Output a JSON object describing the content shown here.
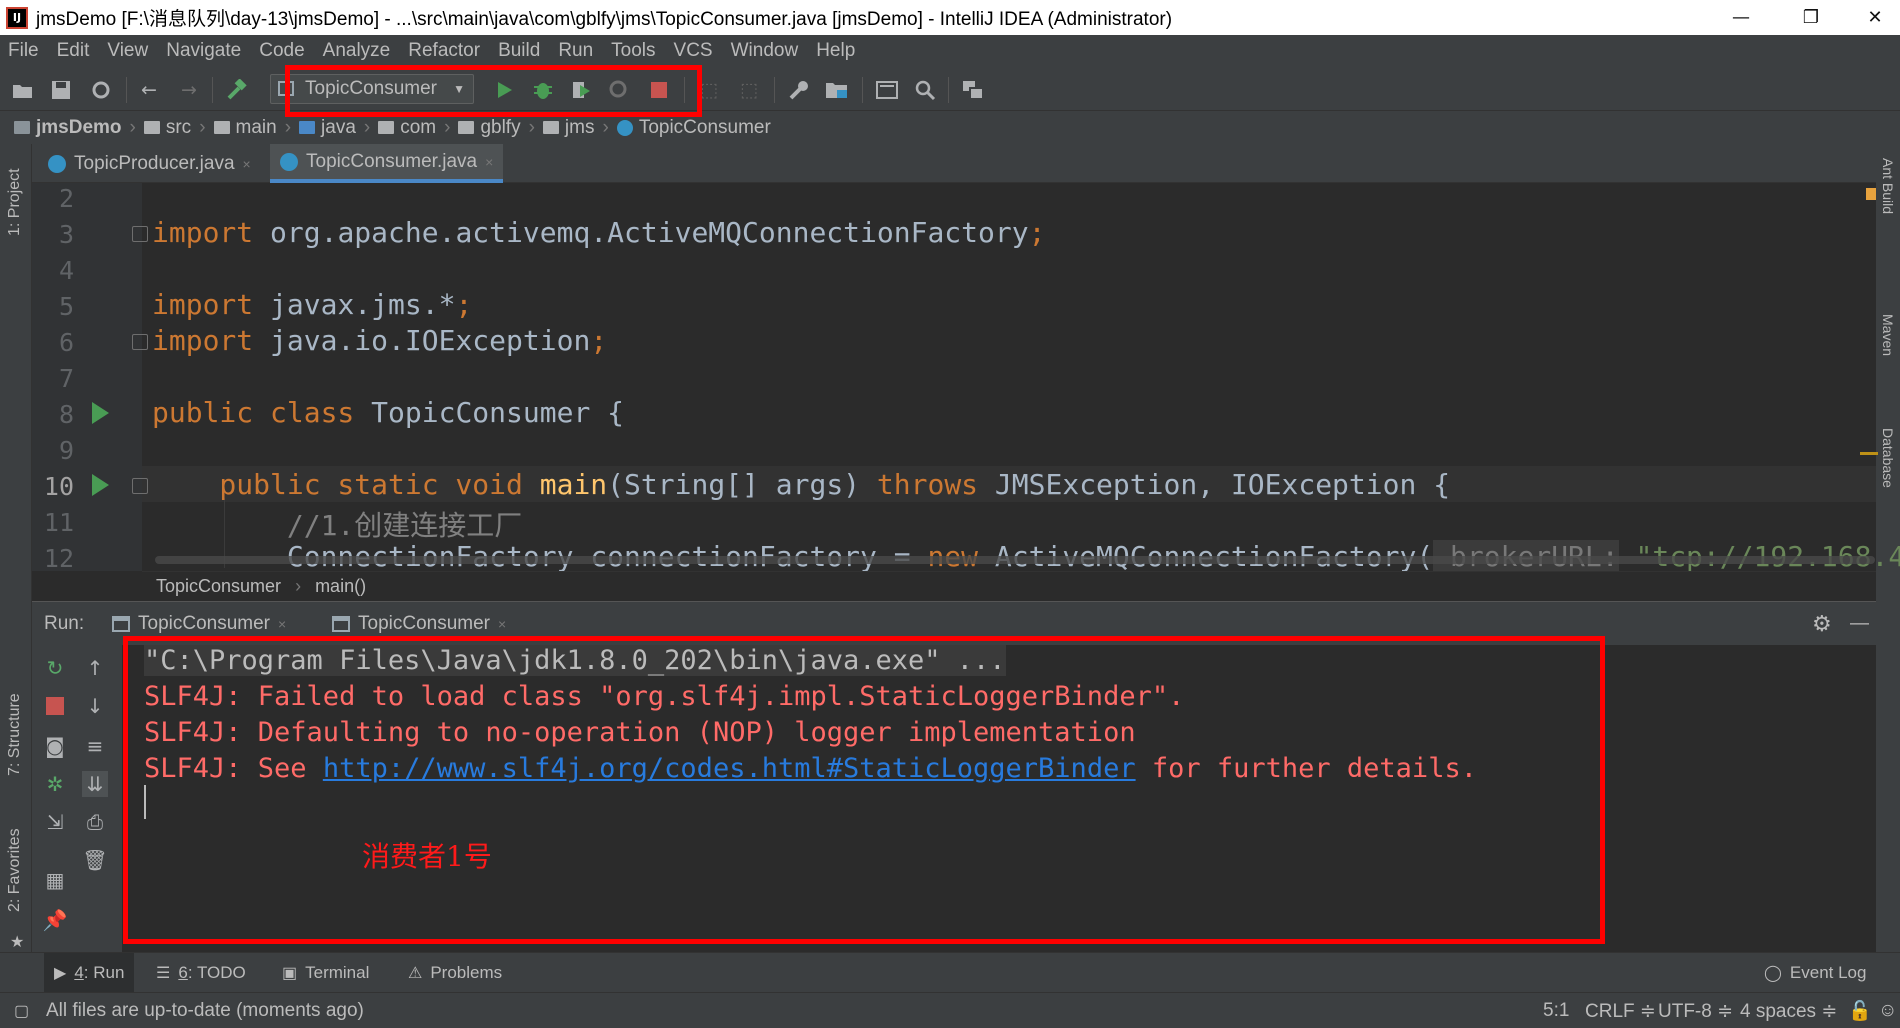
{
  "window": {
    "title": "jmsDemo [F:\\消息队列\\day-13\\jmsDemo] - ...\\src\\main\\java\\com\\gblfy\\jms\\TopicConsumer.java [jmsDemo] - IntelliJ IDEA (Administrator)",
    "app_icon": "IJ",
    "minimize": "—",
    "restore": "❐",
    "close": "✕"
  },
  "menu": [
    "File",
    "Edit",
    "View",
    "Navigate",
    "Code",
    "Analyze",
    "Refactor",
    "Build",
    "Run",
    "Tools",
    "VCS",
    "Window",
    "Help"
  ],
  "toolbar": {
    "run_config": "TopicConsumer",
    "icons": [
      "open-folder-icon",
      "save-icon",
      "sync-icon",
      "back-arrow-icon",
      "forward-arrow-icon",
      "build-hammer-icon",
      "run-icon",
      "debug-icon",
      "coverage-icon",
      "profile-icon",
      "stop-icon",
      "attach-icon",
      "update-icon",
      "settings-wrench-icon",
      "project-structure-icon",
      "terminal-icon",
      "search-icon",
      "tasks-icon"
    ]
  },
  "breadcrumb": [
    "jmsDemo",
    "src",
    "main",
    "java",
    "com",
    "gblfy",
    "jms",
    "TopicConsumer"
  ],
  "left_stripe": {
    "project": "1: Project",
    "structure": "7: Structure",
    "favorites": "2: Favorites"
  },
  "right_stripe": {
    "ant": "Ant Build",
    "maven": "Maven",
    "database": "Database"
  },
  "tabs": [
    {
      "label": "TopicProducer.java",
      "close": "×"
    },
    {
      "label": "TopicConsumer.java",
      "close": "×"
    }
  ],
  "editor": {
    "line_numbers": [
      "2",
      "3",
      "4",
      "5",
      "6",
      "7",
      "8",
      "9",
      "10",
      "11",
      "12"
    ],
    "lines": {
      "l3a": "import",
      "l3b": " org.apache.activemq.ActiveMQConnectionFactory",
      "l3c": ";",
      "l5a": "import",
      "l5b": " javax.jms.*",
      "l5c": ";",
      "l6a": "import",
      "l6b": " java.io.IOException",
      "l6c": ";",
      "l8a": "public class",
      "l8b": " TopicConsumer {",
      "l10a": "    public static void",
      "l10b": " main",
      "l10c": "(String[] args) ",
      "l10d": "throws",
      "l10e": " JMSException, IOException {",
      "l11": "        //1.创建连接工厂",
      "l12a": "        ConnectionFactory connectionFactory = ",
      "l12b": "new",
      "l12c": " ActiveMQConnectionFactory(",
      "l12d": " brokerURL:",
      "l12e": " \"tcp://192.168.4"
    },
    "crumb_class": "TopicConsumer",
    "crumb_method": "main()"
  },
  "run": {
    "label": "Run:",
    "tabs": [
      {
        "label": "TopicConsumer",
        "close": "×"
      },
      {
        "label": "TopicConsumer",
        "close": "×"
      }
    ],
    "settings": "⚙",
    "hide": "—"
  },
  "console": {
    "line1": "\"C:\\Program Files\\Java\\jdk1.8.0_202\\bin\\java.exe\" ...",
    "line2": "SLF4J: Failed to load class \"org.slf4j.impl.StaticLoggerBinder\".",
    "line3": "SLF4J: Defaulting to no-operation (NOP) logger implementation",
    "line4_prefix": "SLF4J: See ",
    "line4_link": "http://www.slf4j.org/codes.html#StaticLoggerBinder",
    "line4_suffix": " for further details.",
    "annotation": "消费者1号"
  },
  "tool_buttons": [
    {
      "num": "4",
      "label": ": Run"
    },
    {
      "num": "6",
      "label": ": TODO"
    },
    {
      "label": "Terminal"
    },
    {
      "label": "Problems"
    },
    {
      "label": "Event Log"
    }
  ],
  "status": {
    "message": "All files are up-to-date (moments ago)",
    "position": "5:1",
    "line_sep": "CRLF ≑",
    "encoding": "UTF-8 ≑",
    "indent": "4 spaces ≑"
  },
  "colors": {
    "keyword": "#cc7832",
    "function": "#ffc66d",
    "console_error": "#ff6b68",
    "link": "#287bde",
    "highlight_box": "#ff0000"
  }
}
